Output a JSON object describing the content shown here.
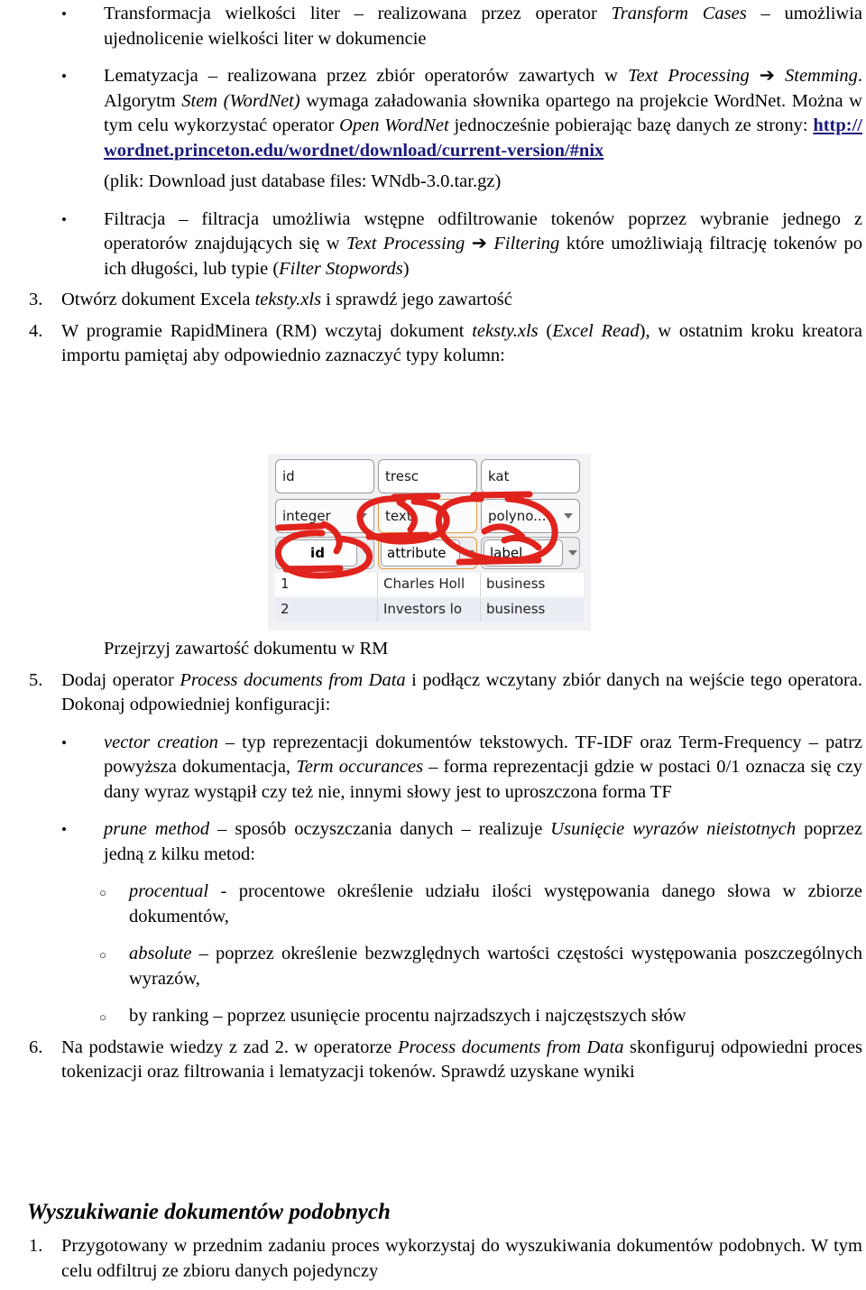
{
  "document": {
    "blocks": [
      {
        "kind": "bullet1",
        "marker": "•",
        "id": "bullet-transform-cases",
        "runs": [
          {
            "t": "Transformacja wielkości liter – realizowana przez operator ",
            "s": "n"
          },
          {
            "t": "Transform Cases",
            "s": "i"
          },
          {
            "t": " – umożliwia ujednolicenie wielkości liter w dokumencie",
            "s": "n"
          }
        ]
      },
      {
        "kind": "bullet1",
        "marker": "•",
        "id": "bullet-lematyzacja",
        "runs": [
          {
            "t": "Lematyzacja – realizowana przez zbiór operatorów zawartych w ",
            "s": "n"
          },
          {
            "t": "Text Processing",
            "s": "i"
          },
          {
            "t": " ➔ ",
            "s": "n"
          },
          {
            "t": "Stemming",
            "s": "i"
          },
          {
            "t": ". Algorytm ",
            "s": "n"
          },
          {
            "t": "Stem (WordNet)",
            "s": "i"
          },
          {
            "t": " wymaga załadowania słownika opartego na projekcie WordNet. Można w tym celu wykorzystać operator ",
            "s": "n"
          },
          {
            "t": "Open WordNet",
            "s": "i"
          },
          {
            "t": " jednocześnie pobierając bazę danych ze strony: ",
            "s": "n"
          },
          {
            "t": "http://wordnet.princeton.edu/wordnet/download/current-version/#nix",
            "s": "link"
          }
        ]
      },
      {
        "kind": "plain115",
        "id": "note-wndb-file",
        "runs": [
          {
            "t": "(plik: Download just database files:  WNdb-3.0.tar.gz)",
            "s": "n"
          }
        ]
      },
      {
        "kind": "bullet1",
        "marker": "•",
        "id": "bullet-filtracja",
        "runs": [
          {
            "t": "Filtracja – filtracja umożliwia wstępne odfiltrowanie tokenów poprzez wybranie jednego z operatorów znajdujących się w  ",
            "s": "n"
          },
          {
            "t": "Text Processing",
            "s": "i"
          },
          {
            "t": " ➔ ",
            "s": "n"
          },
          {
            "t": "Filtering",
            "s": "i"
          },
          {
            "t": " które umożliwiają filtrację tokenów po ich długości, lub typie (",
            "s": "n"
          },
          {
            "t": "Filter Stopwords",
            "s": "i"
          },
          {
            "t": ")",
            "s": "n"
          }
        ]
      },
      {
        "kind": "num1",
        "marker": "3.",
        "id": "step-3-open-excel",
        "runs": [
          {
            "t": "Otwórz dokument Excela ",
            "s": "n"
          },
          {
            "t": "teksty.xls",
            "s": "i"
          },
          {
            "t": " i sprawdź jego zawartość",
            "s": "n"
          }
        ]
      },
      {
        "kind": "num1",
        "marker": "4.",
        "id": "step-4-rapidminer-import",
        "runs": [
          {
            "t": "W programie RapidMinera (RM) wczytaj dokument ",
            "s": "n"
          },
          {
            "t": "teksty.xls",
            "s": "i"
          },
          {
            "t": " (",
            "s": "n"
          },
          {
            "t": "Excel Read",
            "s": "i"
          },
          {
            "t": "), w ostatnim kroku kreatora importu pamiętaj aby odpowiednio zaznaczyć typy kolumn:",
            "s": "n"
          }
        ]
      },
      {
        "kind": "plain115",
        "id": "caption-przejrzyj",
        "runs": [
          {
            "t": "Przejrzyj zawartość dokumentu w RM",
            "s": "n"
          }
        ]
      },
      {
        "kind": "num1",
        "marker": "5.",
        "id": "step-5-process-documents",
        "runs": [
          {
            "t": "Dodaj operator ",
            "s": "n"
          },
          {
            "t": "Process documents from Data",
            "s": "i"
          },
          {
            "t": " i podłącz wczytany zbiór danych na wejście tego operatora. Dokonaj odpowiedniej konfiguracji:",
            "s": "n"
          }
        ]
      },
      {
        "kind": "bullet1",
        "marker": "•",
        "id": "bullet-vector-creation",
        "runs": [
          {
            "t": "vector creation",
            "s": "i"
          },
          {
            "t": " – typ reprezentacji dokumentów tekstowych. TF-IDF oraz Term-Frequency – patrz powyższa dokumentacja,  ",
            "s": "n"
          },
          {
            "t": "Term occurances",
            "s": "i"
          },
          {
            "t": " – forma reprezentacji gdzie w postaci 0/1 oznacza się czy dany wyraz wystąpił czy też nie, innymi słowy jest to uproszczona forma TF",
            "s": "n"
          }
        ]
      },
      {
        "kind": "bullet1",
        "marker": "•",
        "id": "bullet-prune-method",
        "runs": [
          {
            "t": "prune method",
            "s": "i"
          },
          {
            "t": " – sposób oczyszczania danych – realizuje ",
            "s": "n"
          },
          {
            "t": "Usunięcie wyrazów nieistotnych",
            "s": "i"
          },
          {
            "t": " poprzez jedną z kilku metod:",
            "s": "n"
          }
        ]
      },
      {
        "kind": "bullet2",
        "marker": "○",
        "id": "subbullet-procentual",
        "runs": [
          {
            "t": "procentual",
            "s": "i"
          },
          {
            "t": "  - procentowe określenie udziału ilości występowania danego słowa w zbiorze dokumentów,",
            "s": "n"
          }
        ]
      },
      {
        "kind": "bullet2",
        "marker": "○",
        "id": "subbullet-absolute",
        "runs": [
          {
            "t": "absolute",
            "s": "i"
          },
          {
            "t": " – poprzez określenie bezwzględnych wartości częstości występowania poszczególnych wyrazów,",
            "s": "n"
          }
        ]
      },
      {
        "kind": "bullet2",
        "marker": "○",
        "id": "subbullet-by-ranking",
        "runs": [
          {
            "t": "by ranking – poprzez usunięcie procentu najrzadszych i najczęstszych słów",
            "s": "n"
          }
        ]
      },
      {
        "kind": "num1",
        "marker": "6.",
        "id": "step-6-tokenization",
        "runs": [
          {
            "t": "Na podstawie wiedzy z zad 2. w operatorze   ",
            "s": "n"
          },
          {
            "t": "Process documents from Data",
            "s": "i"
          },
          {
            "t": " skonfiguruj odpowiedni proces tokenizacji oraz filtrowania i lematyzacji tokenów. Sprawdź uzyskane wyniki",
            "s": "n"
          }
        ]
      }
    ],
    "section_heading": "Wyszukiwanie dokumentów podobnych",
    "final_blocks": [
      {
        "kind": "num1",
        "marker": "1.",
        "id": "step-1-similar-docs",
        "runs": [
          {
            "t": "Przygotowany w przednim zadaniu proces wykorzystaj do wyszukiwania dokumentów podobnych. W tym celu odfiltruj ze zbioru danych pojedynczy",
            "s": "n"
          }
        ]
      }
    ]
  },
  "rapidminer_screenshot": {
    "alt": "RapidMiner Excel import wizard column type selection with red hand-drawn annotations",
    "columns": [
      {
        "name": "id",
        "type": "integer",
        "role": "id",
        "role_selected": true,
        "type_highlighted": false,
        "circled": true
      },
      {
        "name": "tresc",
        "type": "text",
        "role": "attribute",
        "role_selected": false,
        "type_highlighted": true,
        "circled": true
      },
      {
        "name": "kat",
        "type": "polyno...",
        "role": "label",
        "role_selected": false,
        "type_highlighted": true,
        "circled": true
      }
    ],
    "data_rows": [
      {
        "id": "1",
        "tresc": "Charles Holl",
        "kat": "business"
      },
      {
        "id": "2",
        "tresc": "Investors lo",
        "kat": "business"
      }
    ],
    "annotation_color": "#e0231c"
  }
}
